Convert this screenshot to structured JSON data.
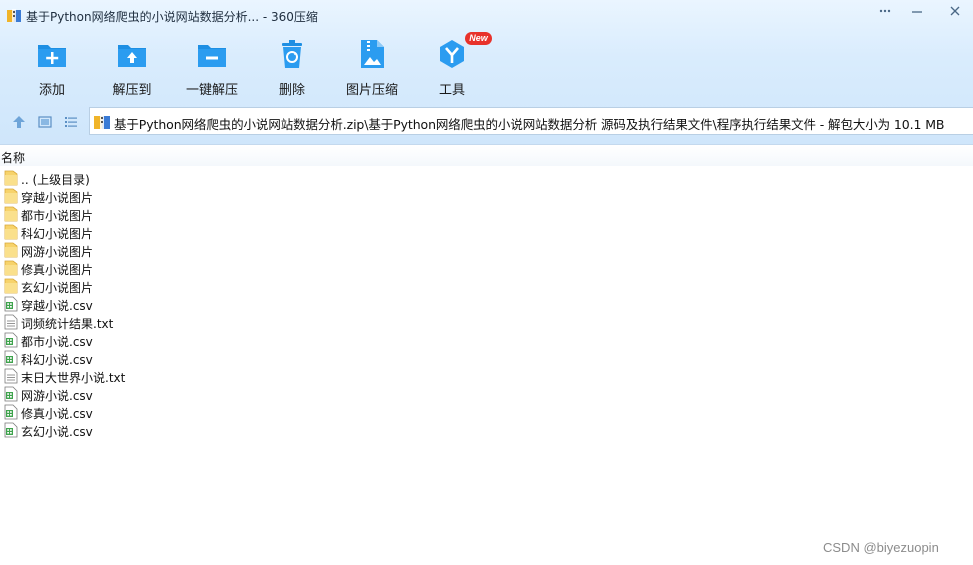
{
  "window": {
    "title": "基于Python网络爬虫的小说网站数据分析... - 360压缩"
  },
  "toolbar": {
    "items": [
      {
        "label": "添加",
        "icon": "add-folder-icon"
      },
      {
        "label": "解压到",
        "icon": "extract-to-icon"
      },
      {
        "label": "一键解压",
        "icon": "one-click-extract-icon"
      },
      {
        "label": "删除",
        "icon": "recycle-bin-icon"
      },
      {
        "label": "图片压缩",
        "icon": "image-compress-icon"
      },
      {
        "label": "工具",
        "icon": "tools-icon",
        "badge": "New"
      }
    ]
  },
  "address": {
    "path": "基于Python网络爬虫的小说网站数据分析.zip\\基于Python网络爬虫的小说网站数据分析 源码及执行结果文件\\程序执行结果文件 - 解包大小为 10.1 MB"
  },
  "list": {
    "column_name": "名称",
    "rows": [
      {
        "name": ".. (上级目录)",
        "type": "folder"
      },
      {
        "name": "穿越小说图片",
        "type": "folder"
      },
      {
        "name": "都市小说图片",
        "type": "folder"
      },
      {
        "name": "科幻小说图片",
        "type": "folder"
      },
      {
        "name": "网游小说图片",
        "type": "folder"
      },
      {
        "name": "修真小说图片",
        "type": "folder"
      },
      {
        "name": "玄幻小说图片",
        "type": "folder"
      },
      {
        "name": "穿越小说.csv",
        "type": "csv"
      },
      {
        "name": "词频统计结果.txt",
        "type": "txt"
      },
      {
        "name": "都市小说.csv",
        "type": "csv"
      },
      {
        "name": "科幻小说.csv",
        "type": "csv"
      },
      {
        "name": "末日大世界小说.txt",
        "type": "txt"
      },
      {
        "name": "网游小说.csv",
        "type": "csv"
      },
      {
        "name": "修真小说.csv",
        "type": "csv"
      },
      {
        "name": "玄幻小说.csv",
        "type": "csv"
      }
    ]
  },
  "watermark": "CSDN @biyezuopin",
  "colors": {
    "accent": "#1e8fe3",
    "chrome": "#d9ecfd",
    "folder": "#f7d36b",
    "csv": "#3fa34d",
    "badge": "#e8322b"
  }
}
